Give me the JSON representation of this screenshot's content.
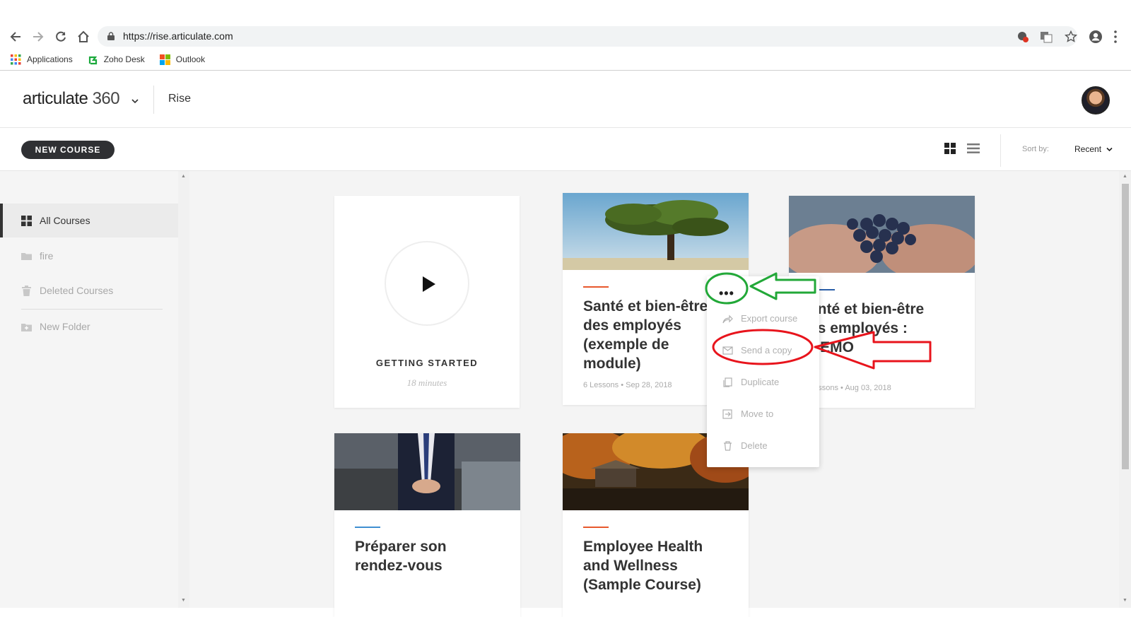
{
  "browser": {
    "url": "https://rise.articulate.com",
    "bookmarks": [
      {
        "label": "Applications",
        "icon": "apps-grid-icon"
      },
      {
        "label": "Zoho Desk",
        "icon": "zoho-desk-icon"
      },
      {
        "label": "Outlook",
        "icon": "windows-logo-icon"
      }
    ]
  },
  "header": {
    "logo_text": "articulate",
    "logo_number": "360",
    "product": "Rise"
  },
  "toolbar": {
    "new_course_label": "NEW COURSE",
    "sort_label": "Sort by:",
    "sort_value": "Recent"
  },
  "sidebar": {
    "items": [
      {
        "label": "All Courses",
        "icon": "grid-icon",
        "active": true
      },
      {
        "label": "fire",
        "icon": "folder-icon"
      },
      {
        "label": "Deleted Courses",
        "icon": "trash-icon"
      },
      {
        "label": "New Folder",
        "icon": "add-folder-icon"
      }
    ]
  },
  "getting_started": {
    "title": "GETTING STARTED",
    "duration": "18 minutes"
  },
  "courses": [
    {
      "title": "Santé et bien-être des employés (exemple de module)",
      "meta": "6 Lessons • Sep 28, 2018",
      "accent": "#e8582c"
    },
    {
      "title": "Santé et bien-être des employés : DEMO",
      "meta": "6 Lessons • Aug 03, 2018",
      "accent": "#2a5ea8"
    },
    {
      "title": "Préparer son rendez-vous",
      "meta": "",
      "accent": "#3f8fd1"
    },
    {
      "title": "Employee Health and Wellness (Sample Course)",
      "meta": "",
      "accent": "#e8582c"
    }
  ],
  "visible_text": {
    "course2_title": "anté et bien-être\nes employés :\nDEMO",
    "course2_meta": "Lessons • Aug 03, 2018",
    "course1_title_visible": "Santé et bien-être\ndes employés\n(exemple de\nmodule)"
  },
  "context_menu": {
    "trigger": "•••",
    "items": [
      {
        "label": "Export course",
        "icon": "share-arrow-icon"
      },
      {
        "label": "Send a copy",
        "icon": "envelope-icon"
      },
      {
        "label": "Duplicate",
        "icon": "copy-icon"
      },
      {
        "label": "Move to",
        "icon": "move-icon"
      },
      {
        "label": "Delete",
        "icon": "trash-icon"
      }
    ]
  },
  "annotations": {
    "green": "#22a838",
    "red": "#e8141c"
  }
}
